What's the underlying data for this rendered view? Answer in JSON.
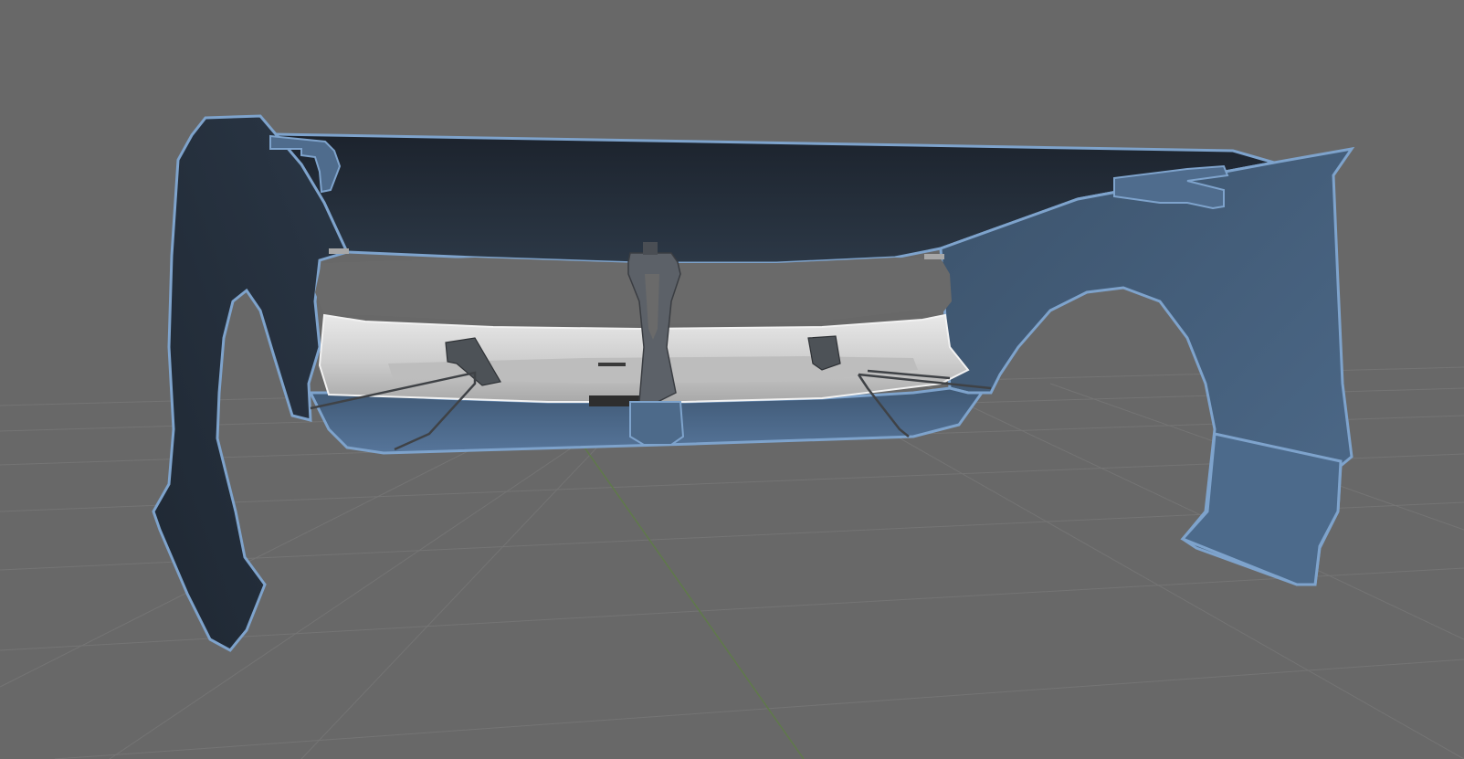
{
  "viewport": {
    "background_color": "#686868",
    "grid_color": "#747474",
    "y_axis_color": "#5f7a4a"
  },
  "model": {
    "outer_surface_color": "#4e6b8c",
    "outer_edge_color": "#7ea3cc",
    "inner_surface_color": "#2a3441",
    "inner_dark_color": "#1e2530",
    "bumper_beam_color": "#d9d9d9",
    "bracket_color": "#5a5e64",
    "wire_color": "#3f4246"
  }
}
